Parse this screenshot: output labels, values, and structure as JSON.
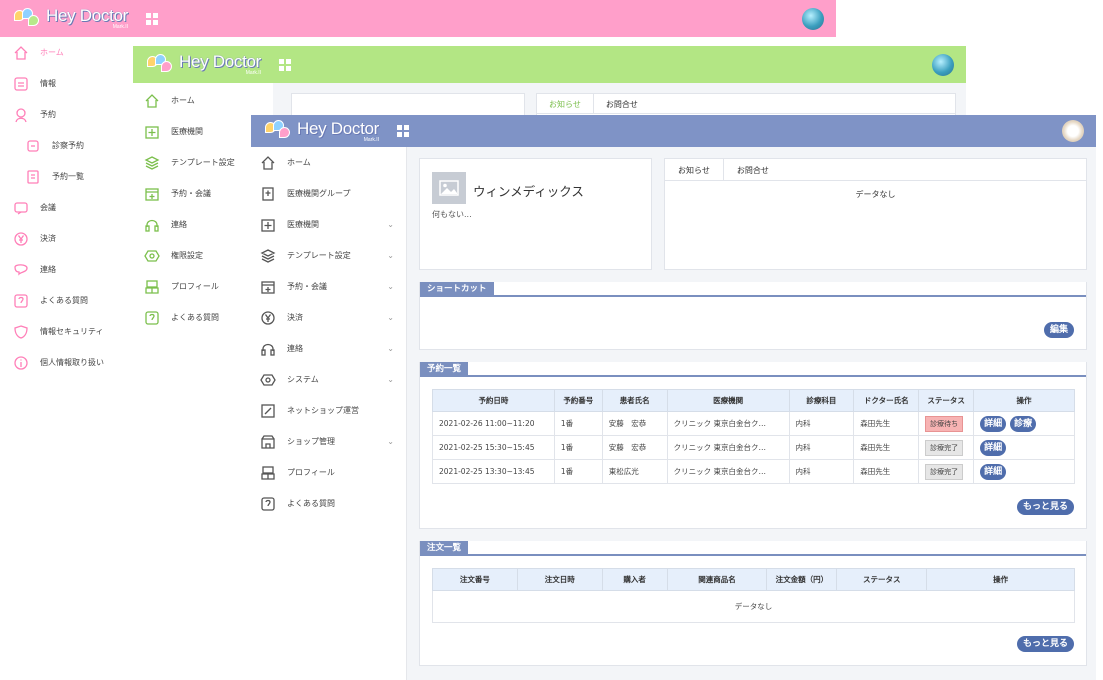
{
  "brand": {
    "title": "Hey Doctor",
    "subtitle": "Mark.II"
  },
  "colors": {
    "pink": "#ff9fca",
    "green": "#b3e684",
    "blue": "#7f93c6",
    "accent": "#4f6dac"
  },
  "pink": {
    "sidebar": [
      {
        "label": "ホーム",
        "icon": "home-icon",
        "active": true
      },
      {
        "label": "情報",
        "icon": "info-icon"
      },
      {
        "label": "予約",
        "icon": "reservation-icon"
      },
      {
        "label": "診察予約",
        "icon": "exam-reservation-icon",
        "sub": true
      },
      {
        "label": "予約一覧",
        "icon": "reservation-list-icon",
        "sub": true
      },
      {
        "label": "会議",
        "icon": "meeting-icon"
      },
      {
        "label": "決済",
        "icon": "yen-icon"
      },
      {
        "label": "連絡",
        "icon": "contact-icon"
      },
      {
        "label": "よくある質問",
        "icon": "faq-icon"
      },
      {
        "label": "情報セキュリティ",
        "icon": "security-icon"
      },
      {
        "label": "個人情報取り扱い",
        "icon": "privacy-icon"
      }
    ]
  },
  "green": {
    "sidebar": [
      {
        "label": "ホーム",
        "icon": "home-icon"
      },
      {
        "label": "医療機関",
        "icon": "hospital-icon"
      },
      {
        "label": "テンプレート設定",
        "icon": "layers-icon"
      },
      {
        "label": "予約・会議",
        "icon": "calendar-icon"
      },
      {
        "label": "連絡",
        "icon": "headset-icon"
      },
      {
        "label": "権限設定",
        "icon": "settings-icon"
      },
      {
        "label": "プロフィール",
        "icon": "profile-icon"
      },
      {
        "label": "よくある質問",
        "icon": "faq-icon"
      }
    ],
    "tabs": [
      "お知らせ",
      "お問合せ"
    ]
  },
  "blue": {
    "sidebar": [
      {
        "label": "ホーム",
        "icon": "home-icon",
        "chev": false
      },
      {
        "label": "医療機関グループ",
        "icon": "hospital-group-icon",
        "chev": false
      },
      {
        "label": "医療機関",
        "icon": "hospital-icon",
        "chev": true
      },
      {
        "label": "テンプレート設定",
        "icon": "layers-icon",
        "chev": true
      },
      {
        "label": "予約・会議",
        "icon": "calendar-icon",
        "chev": true
      },
      {
        "label": "決済",
        "icon": "yen-icon",
        "chev": true
      },
      {
        "label": "連絡",
        "icon": "headset-icon",
        "chev": true
      },
      {
        "label": "システム",
        "icon": "system-icon",
        "chev": true
      },
      {
        "label": "ネットショップ運営",
        "icon": "shop-edit-icon",
        "chev": false
      },
      {
        "label": "ショップ管理",
        "icon": "store-icon",
        "chev": true
      },
      {
        "label": "プロフィール",
        "icon": "profile-icon",
        "chev": false
      },
      {
        "label": "よくある質問",
        "icon": "faq-icon",
        "chev": false
      }
    ],
    "company": {
      "name": "ウィンメディックス",
      "desc": "何もない..."
    },
    "notice": {
      "tabs": [
        "お知らせ",
        "お問合せ"
      ],
      "empty": "データなし"
    },
    "shortcut": {
      "title": "ショートカット",
      "edit": "編集"
    },
    "reservations": {
      "title": "予約一覧",
      "headers": [
        "予約日時",
        "予約番号",
        "患者氏名",
        "医療機関",
        "診療科目",
        "ドクター氏名",
        "ステータス",
        "操作"
      ],
      "rows": [
        {
          "datetime": "2021-02-26 11:00~11:20",
          "number": "1番",
          "patient": "安藤　宏恭",
          "clinic": "クリニック 東京白金台ク…",
          "dept": "内科",
          "doctor": "森田先生",
          "status": "診療待ち",
          "status_type": "waiting",
          "actions": [
            "詳細",
            "診療"
          ]
        },
        {
          "datetime": "2021-02-25 15:30~15:45",
          "number": "1番",
          "patient": "安藤　宏恭",
          "clinic": "クリニック 東京白金台ク…",
          "dept": "内科",
          "doctor": "森田先生",
          "status": "診療完了",
          "status_type": "done",
          "actions": [
            "詳細"
          ]
        },
        {
          "datetime": "2021-02-25 13:30~13:45",
          "number": "1番",
          "patient": "東松広光",
          "clinic": "クリニック 東京白金台ク…",
          "dept": "内科",
          "doctor": "森田先生",
          "status": "診療完了",
          "status_type": "done",
          "actions": [
            "詳細"
          ]
        }
      ],
      "more": "もっと見る"
    },
    "orders": {
      "title": "注文一覧",
      "headers": [
        "注文番号",
        "注文日時",
        "購入者",
        "関連商品名",
        "注文金額（円）",
        "ステータス",
        "操作"
      ],
      "empty": "データなし",
      "more": "もっと見る"
    }
  }
}
